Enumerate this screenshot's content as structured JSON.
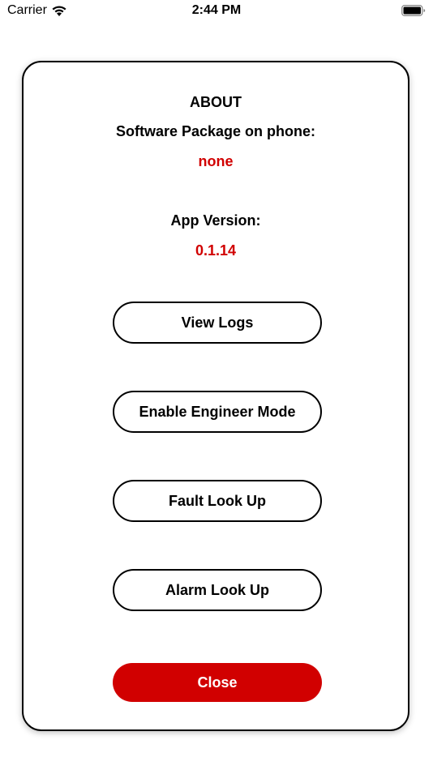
{
  "status_bar": {
    "carrier": "Carrier",
    "time": "2:44 PM",
    "wifi_icon": "wifi-icon",
    "battery_icon": "battery-full-icon"
  },
  "about": {
    "title": "ABOUT",
    "software_package_label": "Software Package on phone:",
    "software_package_value": "none",
    "app_version_label": "App Version:",
    "app_version_value": "0.1.14"
  },
  "buttons": {
    "view_logs": "View Logs",
    "enable_engineer_mode": "Enable Engineer Mode",
    "fault_look_up": "Fault Look Up",
    "alarm_look_up": "Alarm Look Up",
    "close": "Close"
  },
  "colors": {
    "accent_red": "#d10000",
    "border": "#000000",
    "background": "#ffffff"
  }
}
